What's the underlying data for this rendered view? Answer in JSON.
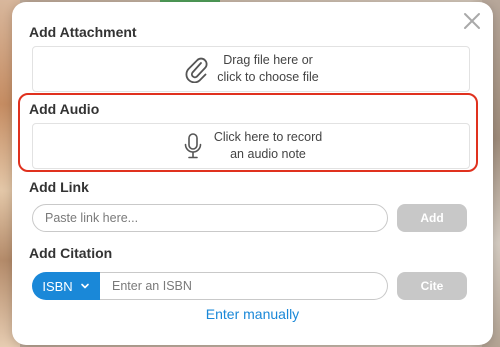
{
  "modal": {
    "close_icon": "close-icon"
  },
  "attachment": {
    "title": "Add Attachment",
    "drop_line1": "Drag file here or",
    "drop_line2": "click to choose file",
    "icon": "paperclip-icon"
  },
  "audio": {
    "title": "Add Audio",
    "line1": "Click here to record",
    "line2": "an audio note",
    "icon": "microphone-icon",
    "highlight_color": "#e0311e"
  },
  "link": {
    "title": "Add Link",
    "placeholder": "Paste link here...",
    "button_label": "Add"
  },
  "citation": {
    "title": "Add Citation",
    "selected_type": "ISBN",
    "placeholder": "Enter an ISBN",
    "button_label": "Cite",
    "manual_link": "Enter manually"
  },
  "colors": {
    "accent": "#1a88d8",
    "button_disabled": "#c8c8c8"
  }
}
